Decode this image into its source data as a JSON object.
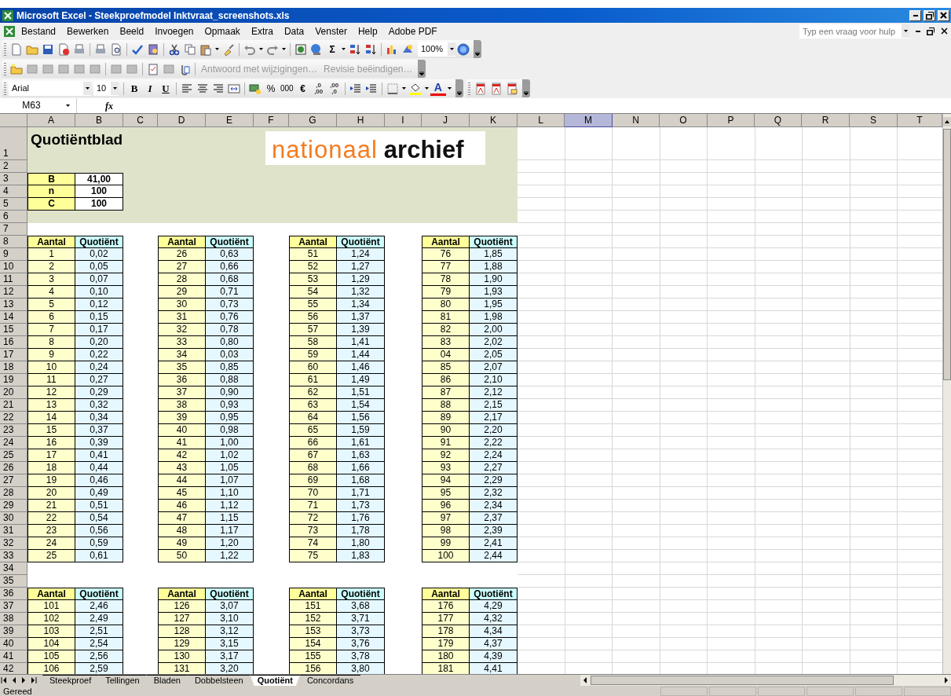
{
  "window": {
    "title": "Microsoft Excel - Steekproefmodel Inktvraat_screenshots.xls"
  },
  "menu": [
    "Bestand",
    "Bewerken",
    "Beeld",
    "Invoegen",
    "Opmaak",
    "Extra",
    "Data",
    "Venster",
    "Help",
    "Adobe PDF"
  ],
  "help_box": {
    "placeholder": "Typ een vraag voor hulp"
  },
  "standard_toolbar": {
    "sum_symbol": "Σ",
    "zoom": "100%"
  },
  "reviewing_toolbar": {
    "buttons": [
      {
        "label": "Antwoord met wijzigingen…",
        "disabled": true
      },
      {
        "label": "Revisie beëindigen…",
        "disabled": true
      }
    ]
  },
  "formatting_toolbar": {
    "font": "Arial",
    "size": "10",
    "style_buttons": [
      "B",
      "I",
      "U"
    ],
    "number_buttons": [
      "%",
      "000",
      "€"
    ],
    "decimal_buttons": [
      [
        ",0",
        ",00"
      ],
      [
        ",00",
        ",0"
      ]
    ],
    "font_color_label": "A"
  },
  "formula_bar": {
    "name_box": "M63",
    "function_label": "fx"
  },
  "sheet": {
    "columns": [
      {
        "label": "A",
        "selected": false
      },
      {
        "label": "B",
        "selected": false
      },
      {
        "label": "C",
        "selected": false
      },
      {
        "label": "D",
        "selected": false
      },
      {
        "label": "E",
        "selected": false
      },
      {
        "label": "F",
        "selected": false
      },
      {
        "label": "G",
        "selected": false
      },
      {
        "label": "H",
        "selected": false
      },
      {
        "label": "I",
        "selected": false
      },
      {
        "label": "J",
        "selected": false
      },
      {
        "label": "K",
        "selected": false
      },
      {
        "label": "L",
        "selected": false
      },
      {
        "label": "M",
        "selected": true
      },
      {
        "label": "N",
        "selected": false
      },
      {
        "label": "O",
        "selected": false
      },
      {
        "label": "P",
        "selected": false
      },
      {
        "label": "Q",
        "selected": false
      },
      {
        "label": "R",
        "selected": false
      },
      {
        "label": "S",
        "selected": false
      },
      {
        "label": "T",
        "selected": false
      }
    ],
    "row_numbers": [
      "1",
      "2",
      "3",
      "4",
      "5",
      "6",
      "7",
      "8",
      "9",
      "10",
      "11",
      "12",
      "13",
      "14",
      "15",
      "16",
      "17",
      "18",
      "19",
      "20",
      "21",
      "22",
      "23",
      "24",
      "25",
      "26",
      "27",
      "28",
      "29",
      "30",
      "31",
      "32",
      "33",
      "34",
      "35",
      "36",
      "37",
      "38",
      "39",
      "40",
      "41",
      "42"
    ],
    "title": "Quotiëntblad",
    "logo": [
      "nationaal",
      "archief"
    ],
    "parameters": [
      {
        "label": "B",
        "value": "41,00"
      },
      {
        "label": "n",
        "value": "100"
      },
      {
        "label": "C",
        "value": "100"
      }
    ],
    "tables": [
      {
        "header": [
          "Aantal",
          "Quotiënt"
        ],
        "rows": [
          [
            "1",
            "0,02"
          ],
          [
            "2",
            "0,05"
          ],
          [
            "3",
            "0,07"
          ],
          [
            "4",
            "0,10"
          ],
          [
            "5",
            "0,12"
          ],
          [
            "6",
            "0,15"
          ],
          [
            "7",
            "0,17"
          ],
          [
            "8",
            "0,20"
          ],
          [
            "9",
            "0,22"
          ],
          [
            "10",
            "0,24"
          ],
          [
            "11",
            "0,27"
          ],
          [
            "12",
            "0,29"
          ],
          [
            "13",
            "0,32"
          ],
          [
            "14",
            "0,34"
          ],
          [
            "15",
            "0,37"
          ],
          [
            "16",
            "0,39"
          ],
          [
            "17",
            "0,41"
          ],
          [
            "18",
            "0,44"
          ],
          [
            "19",
            "0,46"
          ],
          [
            "20",
            "0,49"
          ],
          [
            "21",
            "0,51"
          ],
          [
            "22",
            "0,54"
          ],
          [
            "23",
            "0,56"
          ],
          [
            "24",
            "0,59"
          ],
          [
            "25",
            "0,61"
          ]
        ]
      },
      {
        "header": [
          "Aantal",
          "Quotiënt"
        ],
        "rows": [
          [
            "26",
            "0,63"
          ],
          [
            "27",
            "0,66"
          ],
          [
            "28",
            "0,68"
          ],
          [
            "29",
            "0,71"
          ],
          [
            "30",
            "0,73"
          ],
          [
            "31",
            "0,76"
          ],
          [
            "32",
            "0,78"
          ],
          [
            "33",
            "0,80"
          ],
          [
            "34",
            "0,03"
          ],
          [
            "35",
            "0,85"
          ],
          [
            "36",
            "0,88"
          ],
          [
            "37",
            "0,90"
          ],
          [
            "38",
            "0,93"
          ],
          [
            "39",
            "0,95"
          ],
          [
            "40",
            "0,98"
          ],
          [
            "41",
            "1,00"
          ],
          [
            "42",
            "1,02"
          ],
          [
            "43",
            "1,05"
          ],
          [
            "44",
            "1,07"
          ],
          [
            "45",
            "1,10"
          ],
          [
            "46",
            "1,12"
          ],
          [
            "47",
            "1,15"
          ],
          [
            "48",
            "1,17"
          ],
          [
            "49",
            "1,20"
          ],
          [
            "50",
            "1,22"
          ]
        ]
      },
      {
        "header": [
          "Aantal",
          "Quotiënt"
        ],
        "rows": [
          [
            "51",
            "1,24"
          ],
          [
            "52",
            "1,27"
          ],
          [
            "53",
            "1,29"
          ],
          [
            "54",
            "1,32"
          ],
          [
            "55",
            "1,34"
          ],
          [
            "56",
            "1,37"
          ],
          [
            "57",
            "1,39"
          ],
          [
            "58",
            "1,41"
          ],
          [
            "59",
            "1,44"
          ],
          [
            "60",
            "1,46"
          ],
          [
            "61",
            "1,49"
          ],
          [
            "62",
            "1,51"
          ],
          [
            "63",
            "1,54"
          ],
          [
            "64",
            "1,56"
          ],
          [
            "65",
            "1,59"
          ],
          [
            "66",
            "1,61"
          ],
          [
            "67",
            "1,63"
          ],
          [
            "68",
            "1,66"
          ],
          [
            "69",
            "1,68"
          ],
          [
            "70",
            "1,71"
          ],
          [
            "71",
            "1,73"
          ],
          [
            "72",
            "1,76"
          ],
          [
            "73",
            "1,78"
          ],
          [
            "74",
            "1,80"
          ],
          [
            "75",
            "1,83"
          ]
        ]
      },
      {
        "header": [
          "Aantal",
          "Quotiënt"
        ],
        "rows": [
          [
            "76",
            "1,85"
          ],
          [
            "77",
            "1,88"
          ],
          [
            "78",
            "1,90"
          ],
          [
            "79",
            "1,93"
          ],
          [
            "80",
            "1,95"
          ],
          [
            "81",
            "1,98"
          ],
          [
            "82",
            "2,00"
          ],
          [
            "83",
            "2,02"
          ],
          [
            "04",
            "2,05"
          ],
          [
            "85",
            "2,07"
          ],
          [
            "86",
            "2,10"
          ],
          [
            "87",
            "2,12"
          ],
          [
            "88",
            "2,15"
          ],
          [
            "89",
            "2,17"
          ],
          [
            "90",
            "2,20"
          ],
          [
            "91",
            "2,22"
          ],
          [
            "92",
            "2,24"
          ],
          [
            "93",
            "2,27"
          ],
          [
            "94",
            "2,29"
          ],
          [
            "95",
            "2,32"
          ],
          [
            "96",
            "2,34"
          ],
          [
            "97",
            "2,37"
          ],
          [
            "98",
            "2,39"
          ],
          [
            "99",
            "2,41"
          ],
          [
            "100",
            "2,44"
          ]
        ]
      },
      {
        "header": [
          "Aantal",
          "Quotiënt"
        ],
        "rows": [
          [
            "101",
            "2,46"
          ],
          [
            "102",
            "2,49"
          ],
          [
            "103",
            "2,51"
          ],
          [
            "104",
            "2,54"
          ],
          [
            "105",
            "2,56"
          ],
          [
            "106",
            "2,59"
          ]
        ]
      },
      {
        "header": [
          "Aantal",
          "Quotiënt"
        ],
        "rows": [
          [
            "126",
            "3,07"
          ],
          [
            "127",
            "3,10"
          ],
          [
            "128",
            "3,12"
          ],
          [
            "129",
            "3,15"
          ],
          [
            "130",
            "3,17"
          ],
          [
            "131",
            "3,20"
          ]
        ]
      },
      {
        "header": [
          "Aantal",
          "Quotiënt"
        ],
        "rows": [
          [
            "151",
            "3,68"
          ],
          [
            "152",
            "3,71"
          ],
          [
            "153",
            "3,73"
          ],
          [
            "154",
            "3,76"
          ],
          [
            "155",
            "3,78"
          ],
          [
            "156",
            "3,80"
          ]
        ]
      },
      {
        "header": [
          "Aantal",
          "Quotiënt"
        ],
        "rows": [
          [
            "176",
            "4,29"
          ],
          [
            "177",
            "4,32"
          ],
          [
            "178",
            "4,34"
          ],
          [
            "179",
            "4,37"
          ],
          [
            "180",
            "4,39"
          ],
          [
            "181",
            "4,41"
          ]
        ]
      }
    ]
  },
  "sheet_tabs": [
    {
      "label": "Steekproef",
      "selected": false
    },
    {
      "label": "Tellingen",
      "selected": false
    },
    {
      "label": "Bladen",
      "selected": false
    },
    {
      "label": "Dobbelsteen",
      "selected": false
    },
    {
      "label": "Quotiënt",
      "selected": true
    },
    {
      "label": "Concordans",
      "selected": false
    }
  ],
  "status_bar": {
    "text": "Gereed"
  }
}
